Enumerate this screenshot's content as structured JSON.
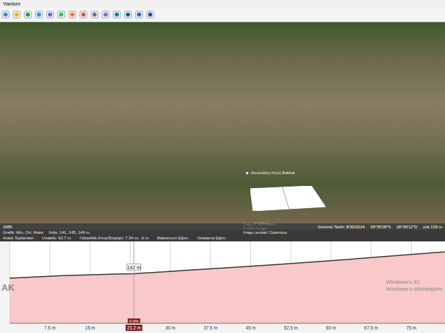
{
  "menu": {
    "items": [
      "Yardım"
    ]
  },
  "imagery": {
    "pin_label": "Deveciköy Köyü Bakkal",
    "credits": [
      "Image © 2026 Maxar",
      "© 2026 Google",
      "Image Landsat / Copernicus"
    ],
    "status_left": "1985",
    "status_right": [
      "Görüntü Tarihi: 8/30/2024",
      "39°55'08\"K",
      "28°38'12\"D",
      "yük 133 m"
    ]
  },
  "profile": {
    "header_line1": [
      "Grafik: Min, Ort, Maks",
      "İrtifa: 141, 145, 149 m"
    ],
    "header_line2": [
      "Aralık Toplamları",
      "Uzaklık: 92.7 m",
      "Yükseklik Artışı/Düşüşü: 7.34 m, -0 m",
      "Maksimum Eğim:",
      "Ortalama Eğim:"
    ],
    "distances": [
      0,
      10,
      20,
      23.2,
      30,
      40,
      50,
      60,
      70,
      80,
      92.7
    ],
    "elevations": [
      140.8,
      141.5,
      141.9,
      142,
      142.6,
      143.5,
      144.4,
      145.4,
      146.5,
      147.6,
      149
    ],
    "ticks": [
      {
        "label": "7.5 m",
        "value": 7.5
      },
      {
        "label": "15 m",
        "value": 15
      },
      {
        "label": "30 m",
        "value": 30
      },
      {
        "label": "37.5 m",
        "value": 37.5
      },
      {
        "label": "45 m",
        "value": 45
      },
      {
        "label": "52.5 m",
        "value": 52.5
      },
      {
        "label": "60 m",
        "value": 60
      },
      {
        "label": "67.5 m",
        "value": 67.5
      },
      {
        "label": "75 m",
        "value": 75
      }
    ],
    "cursor": {
      "distance": 23.2,
      "distance_label": "23.2 m",
      "slope_label": "0.0%",
      "elevation_label": "142 m"
    }
  },
  "watermarks": {
    "left": "AK",
    "right": [
      "Windows'u Et",
      "Windows'u etkinleştirm"
    ]
  }
}
